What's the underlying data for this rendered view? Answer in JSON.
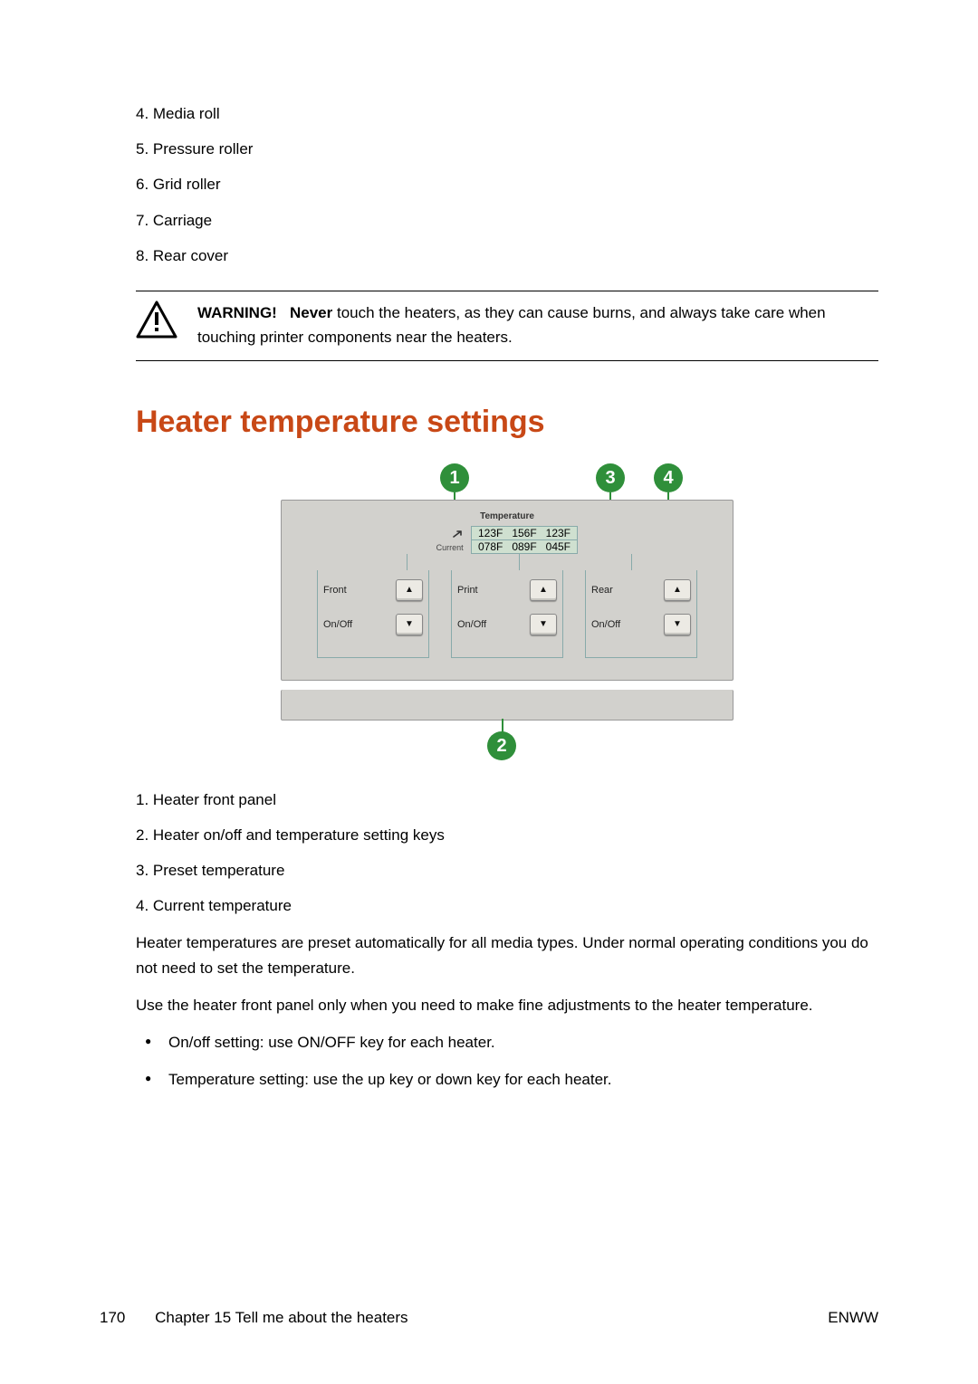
{
  "top_list": [
    "4. Media roll",
    "5. Pressure roller",
    "6. Grid roller",
    "7. Carriage",
    "8. Rear cover"
  ],
  "warning": {
    "label": "WARNING!",
    "text_before": "Never",
    "text_after": " touch the heaters, as they can cause burns, and always take care when touching printer components near the heaters."
  },
  "heading": "Heater temperature settings",
  "figure": {
    "callouts": {
      "c1": "1",
      "c2": "2",
      "c3": "3",
      "c4": "4"
    },
    "temp_title": "Temperature",
    "current_label": "Current",
    "preset_row": [
      "123F",
      "156F",
      "123F"
    ],
    "current_row": [
      "078F",
      "089F",
      "045F"
    ],
    "heater_cols": [
      {
        "name": "Front",
        "onoff": "On/Off"
      },
      {
        "name": "Print",
        "onoff": "On/Off"
      },
      {
        "name": "Rear",
        "onoff": "On/Off"
      }
    ]
  },
  "numbered_list": [
    "1. Heater front panel",
    "2. Heater on/off and temperature setting keys",
    "3. Preset temperature",
    "4. Current temperature"
  ],
  "para1": "Heater temperatures are preset automatically for all media types. Under normal operating conditions you do not need to set the temperature.",
  "para2": "Use the heater front panel only when you need to make fine adjustments to the heater temperature.",
  "bullets": [
    "On/off setting: use ON/OFF key for each heater.",
    "Temperature setting: use the up key or down key for each heater."
  ],
  "footer": {
    "page": "170",
    "chapter": "Chapter 15    Tell me about the heaters",
    "right": "ENWW"
  }
}
